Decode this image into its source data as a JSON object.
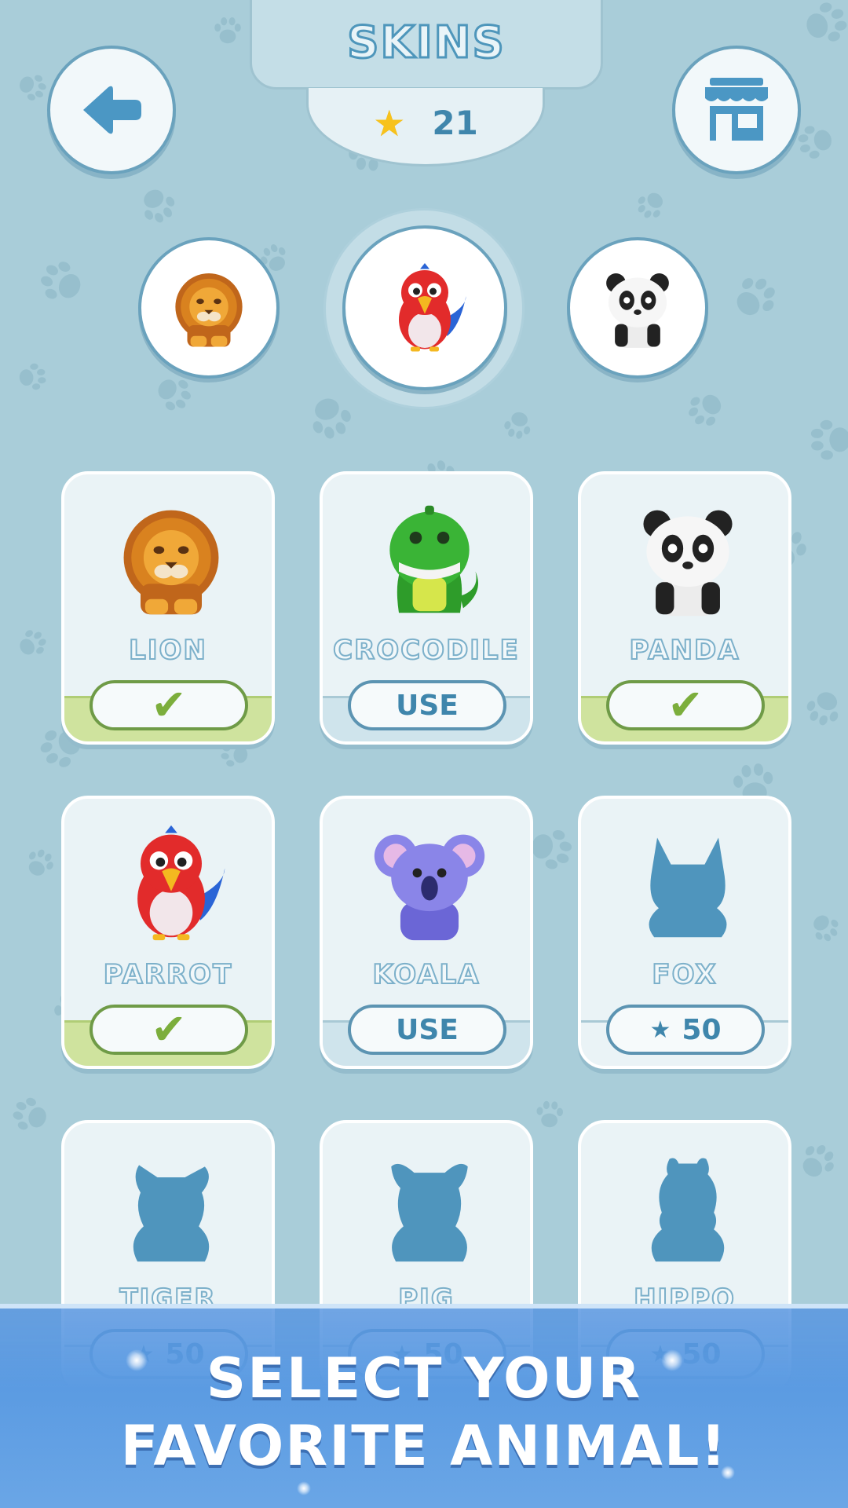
{
  "header": {
    "title": "SKINS",
    "star_count": "21"
  },
  "nav": {
    "back_icon": "back-arrow-icon",
    "shop_icon": "shop-icon"
  },
  "selected_animals": [
    "lion",
    "parrot",
    "panda"
  ],
  "cards": [
    {
      "name": "LION",
      "animal": "lion",
      "state": "owned-selected"
    },
    {
      "name": "CROCODILE",
      "animal": "crocodile",
      "state": "owned",
      "button_label": "USE"
    },
    {
      "name": "PANDA",
      "animal": "panda",
      "state": "owned-selected"
    },
    {
      "name": "PARROT",
      "animal": "parrot",
      "state": "owned-selected"
    },
    {
      "name": "KOALA",
      "animal": "koala",
      "state": "owned",
      "button_label": "USE"
    },
    {
      "name": "FOX",
      "animal": "fox",
      "state": "locked",
      "price": "50"
    },
    {
      "name": "TIGER",
      "animal": "tiger",
      "state": "locked",
      "price": "50"
    },
    {
      "name": "PIG",
      "animal": "pig",
      "state": "locked",
      "price": "50"
    },
    {
      "name": "HIPPO",
      "animal": "hippo",
      "state": "locked",
      "price": "50"
    }
  ],
  "banner": {
    "line1": "SELECT YOUR",
    "line2": "FAVORITE ANIMAL!"
  },
  "colors": {
    "background": "#a9cdd9",
    "accent_blue": "#3f86ac",
    "owned_green": "#7cae3c",
    "banner_blue": "#5b9be2",
    "star_gold": "#f7c21c"
  }
}
